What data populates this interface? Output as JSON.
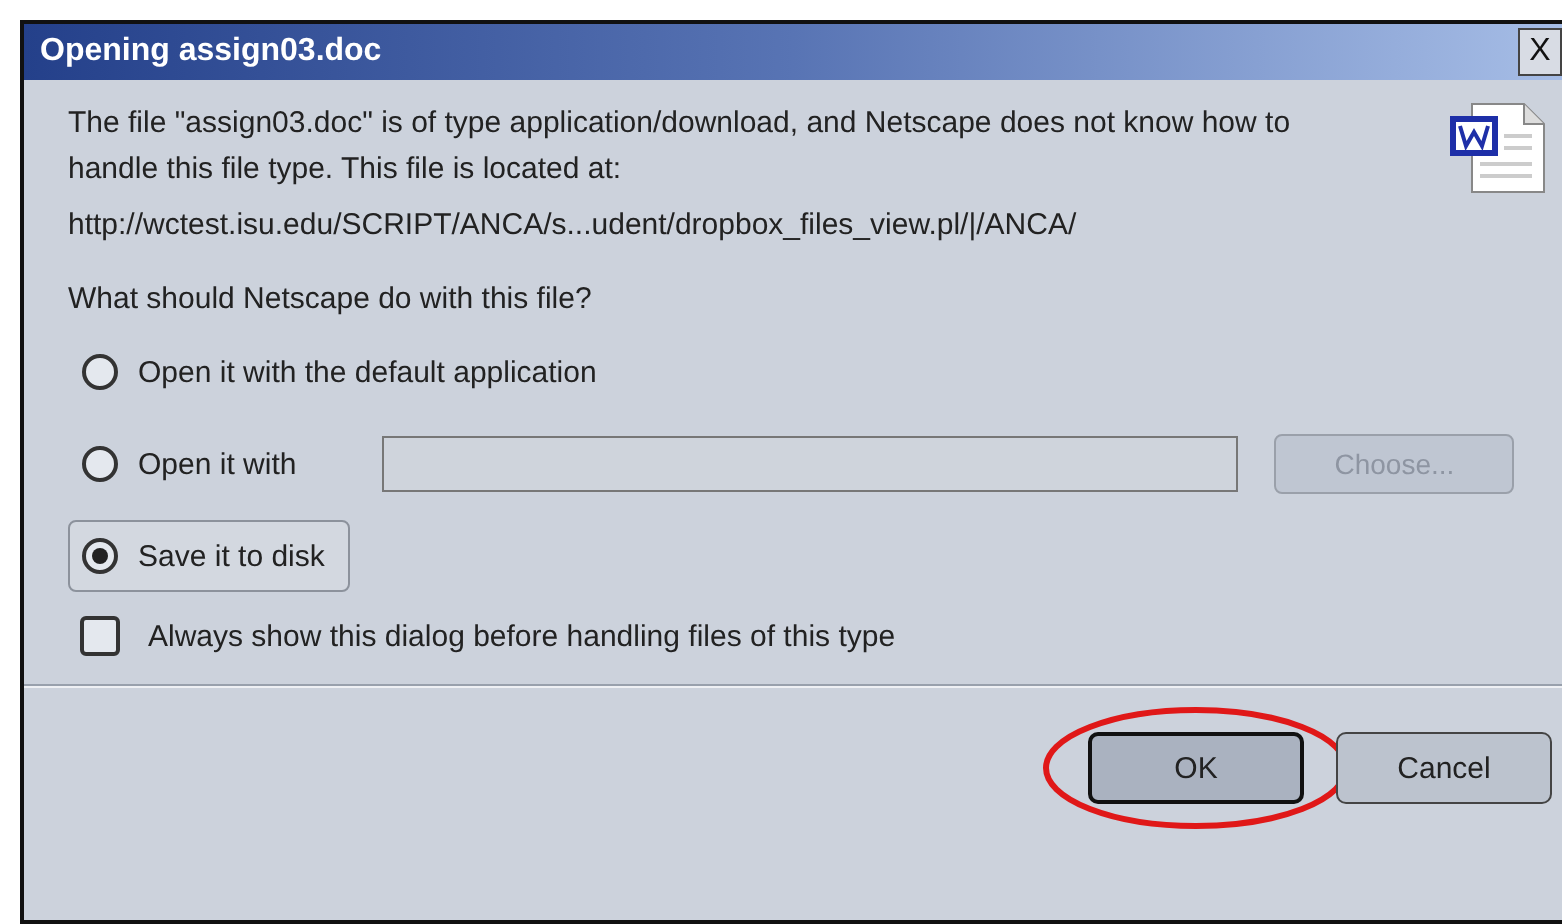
{
  "window": {
    "title": "Opening assign03.doc",
    "close": "X"
  },
  "message": "The file \"assign03.doc\" is of type application/download, and Netscape does not know how to handle this file type. This file is located at:",
  "location": "http://wctest.isu.edu/SCRIPT/ANCA/s...udent/dropbox_files_view.pl/|/ANCA/",
  "question": "What should Netscape do with this file?",
  "options": [
    {
      "kind": "plain",
      "label": "Open it with the default application",
      "selected": false
    },
    {
      "kind": "app",
      "label": "Open it with",
      "selected": false,
      "choose": "Choose...",
      "disabled": true
    },
    {
      "kind": "plain",
      "label": "Save it to disk",
      "selected": true
    }
  ],
  "always_show": {
    "label": "Always show this dialog before handling files of this type",
    "checked": false
  },
  "buttons": [
    {
      "label": "OK",
      "default": true,
      "circled": true
    },
    {
      "label": "Cancel",
      "default": false,
      "circled": false
    }
  ]
}
